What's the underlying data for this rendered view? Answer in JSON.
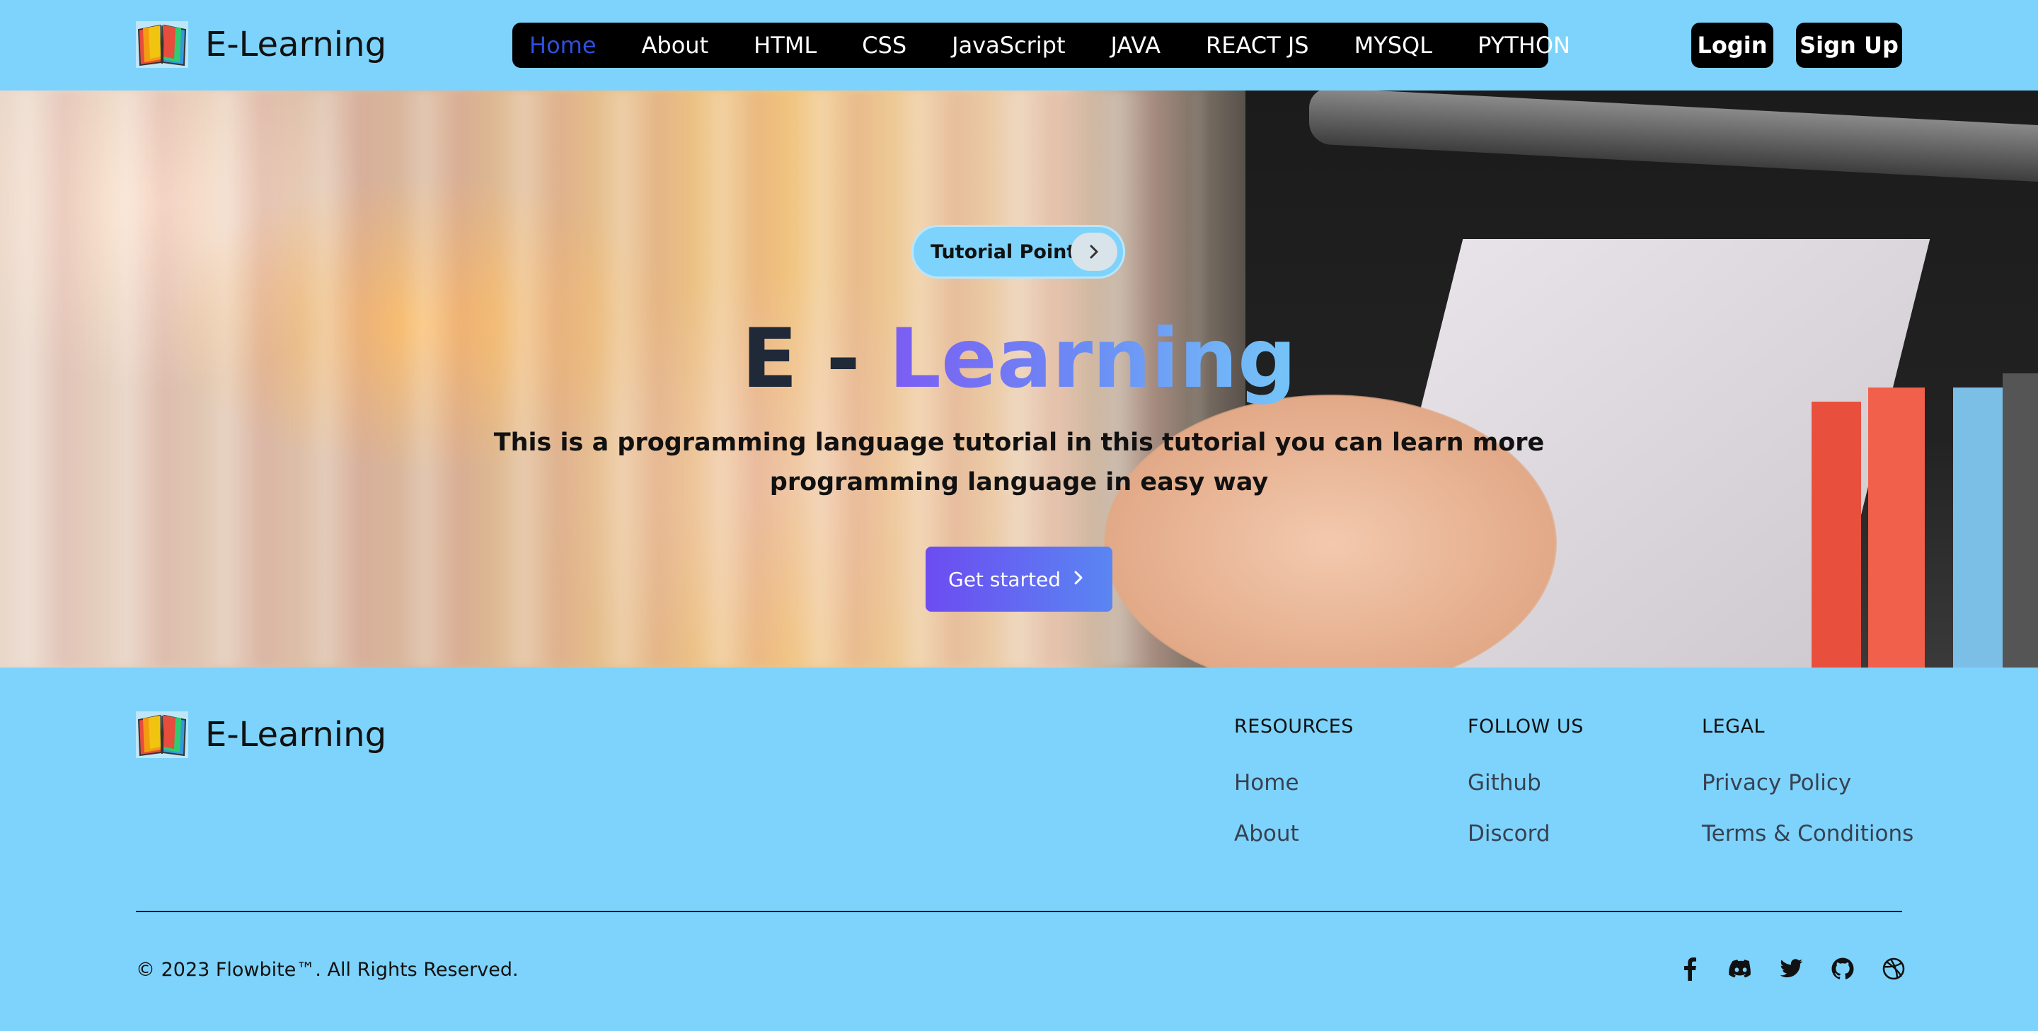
{
  "brand": {
    "name": "E-Learning",
    "logo_icon": "open-book-icon"
  },
  "nav": {
    "items": [
      {
        "label": "Home",
        "active": true
      },
      {
        "label": "About"
      },
      {
        "label": "HTML"
      },
      {
        "label": "CSS"
      },
      {
        "label": "JavaScript"
      },
      {
        "label": "JAVA"
      },
      {
        "label": "REACT JS"
      },
      {
        "label": "MYSQL"
      },
      {
        "label": "PYTHON"
      }
    ],
    "active_color": "#2f4fe0"
  },
  "auth": {
    "login_label": "Login",
    "signup_label": "Sign Up"
  },
  "hero": {
    "badge_label": "Tutorial Point",
    "badge_icon": "chevron-right-icon",
    "title_prefix": "E - ",
    "title_highlight": "Learning",
    "description": "This is a programming language tutorial in this tutorial you can learn more programming language in easy way",
    "cta_label": "Get started",
    "cta_icon": "chevron-right-icon"
  },
  "footer": {
    "brand_name": "E-Learning",
    "columns": [
      {
        "title": "RESOURCES",
        "links": [
          "Home",
          "About"
        ]
      },
      {
        "title": "FOLLOW US",
        "links": [
          "Github",
          "Discord"
        ]
      },
      {
        "title": "LEGAL",
        "links": [
          "Privacy Policy",
          "Terms & Conditions"
        ]
      }
    ],
    "copyright": "© 2023 Flowbite™. All Rights Reserved.",
    "socials": [
      "facebook-icon",
      "discord-icon",
      "twitter-icon",
      "github-icon",
      "dribbble-icon"
    ]
  },
  "colors": {
    "background": "#7dd3fb",
    "nav_bg": "#000000",
    "cta_gradient_start": "#6c4cf1",
    "cta_gradient_end": "#5a86f2",
    "title_gradient_start": "#7c5cf3",
    "title_gradient_end": "#75c6f8"
  }
}
